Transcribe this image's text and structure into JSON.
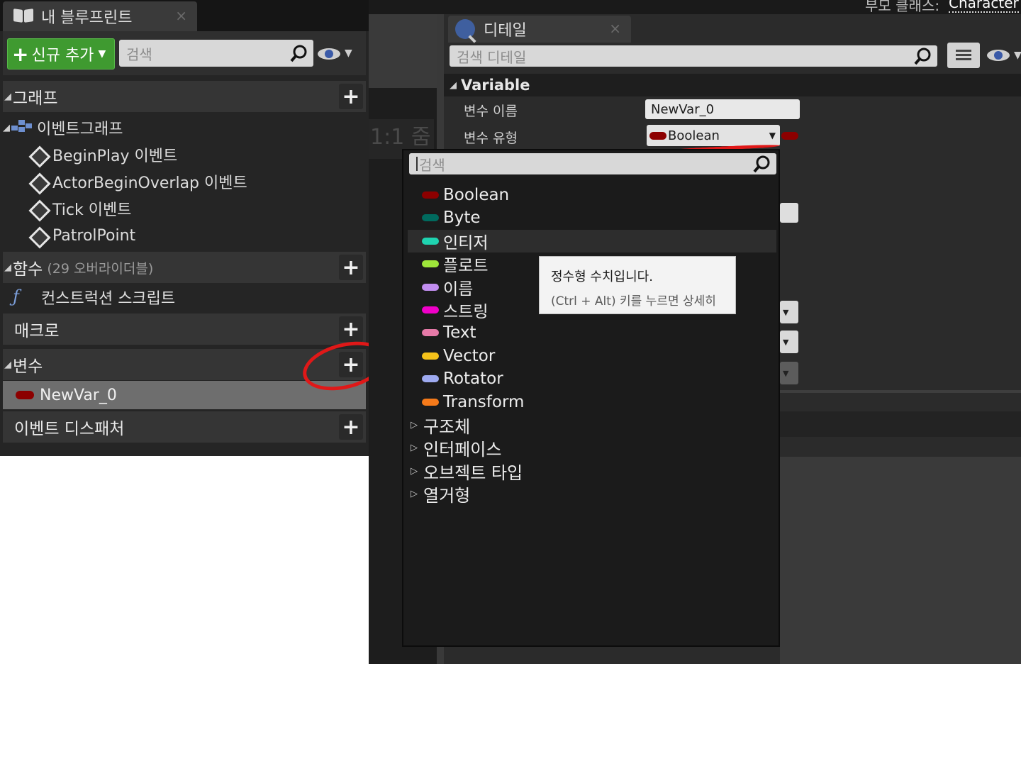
{
  "blueprint_panel": {
    "tab_title": "내 블루프린트",
    "tab_close": "×",
    "add_new_label": "신규 추가",
    "add_new_plus": "+",
    "add_new_caret": "▼",
    "search_placeholder": "검색",
    "section_arrow": "◢",
    "graphs": {
      "title": "그래프",
      "event_graph": "이벤트그래프",
      "events": [
        "BeginPlay 이벤트",
        "ActorBeginOverlap 이벤트",
        "Tick 이벤트",
        "PatrolPoint"
      ]
    },
    "functions": {
      "title": "함수",
      "override_note": "(29 오버라이더블)",
      "construction_script": "컨스트럭션 스크립트",
      "function_glyph": "ƒ"
    },
    "macros": {
      "title": "매크로"
    },
    "variables": {
      "title": "변수",
      "items": [
        "NewVar_0"
      ]
    },
    "event_dispatchers": {
      "title": "이벤트 디스패처"
    },
    "plus_glyph": "+"
  },
  "graph_editor": {
    "parent_class_label": "부모 클래스:",
    "parent_class_value": "Character",
    "zoom_label": "1:1 줌"
  },
  "details_panel": {
    "tab_title": "디테일",
    "tab_close": "×",
    "search_placeholder": "검색 디테일",
    "section_title": "Variable",
    "section_arrow": "◢",
    "variable_name_label": "변수 이름",
    "variable_name_value": "NewVar_0",
    "variable_type_label": "변수 유형",
    "variable_type_value": "Boolean",
    "dropdown_caret": "▼"
  },
  "type_picker": {
    "search_placeholder": "검색",
    "types": [
      {
        "label": "Boolean",
        "color": "#8c0000"
      },
      {
        "label": "Byte",
        "color": "#006a5e"
      },
      {
        "label": "인티저",
        "color": "#1fd3b0"
      },
      {
        "label": "플로트",
        "color": "#9ee63a"
      },
      {
        "label": "이름",
        "color": "#c28ef0"
      },
      {
        "label": "스트링",
        "color": "#f000c8"
      },
      {
        "label": "Text",
        "color": "#e67aa8"
      },
      {
        "label": "Vector",
        "color": "#f5c21a"
      },
      {
        "label": "Rotator",
        "color": "#9eaaf0"
      },
      {
        "label": "Transform",
        "color": "#f57a1a"
      }
    ],
    "hovered_type": "인티저",
    "group_arrow": "▷",
    "groups": [
      "구조체",
      "인터페이스",
      "오브젝트 타입",
      "열거형"
    ],
    "tooltip": {
      "line1": "정수형 수치입니다.",
      "line2": "(Ctrl + Alt) 키를 누르면 상세히"
    }
  },
  "annotations": {
    "highlight_color": "#e01818"
  }
}
